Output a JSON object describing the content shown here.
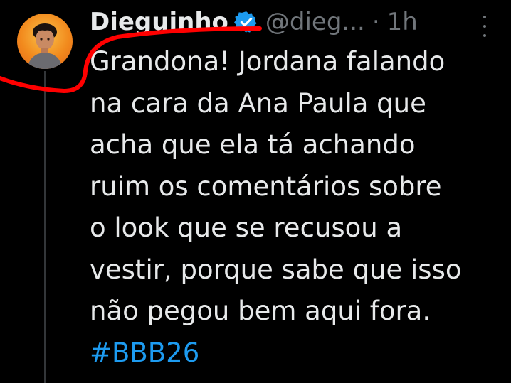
{
  "author": {
    "display_name": "Dieguinho",
    "handle": "@dieg...",
    "separator": "·",
    "time": "1h",
    "verified": true,
    "avatar_icon": "user-avatar-photo"
  },
  "tweet": {
    "lines": [
      "Grandona! Jordana falando",
      "na cara da Ana Paula que",
      "acha que ela tá achando",
      "ruim os comentários sobre",
      "o look que se recusou a",
      "vestir, porque sabe que isso",
      "não pegou bem aqui fora."
    ],
    "hashtag": "#BBB26"
  },
  "icons": {
    "verified": "verified-badge-icon",
    "more": "more-options-icon"
  },
  "colors": {
    "background": "#000000",
    "text": "#e7e9ea",
    "muted": "#71767b",
    "accent": "#1d9bf0",
    "annotation": "#ff0000"
  }
}
